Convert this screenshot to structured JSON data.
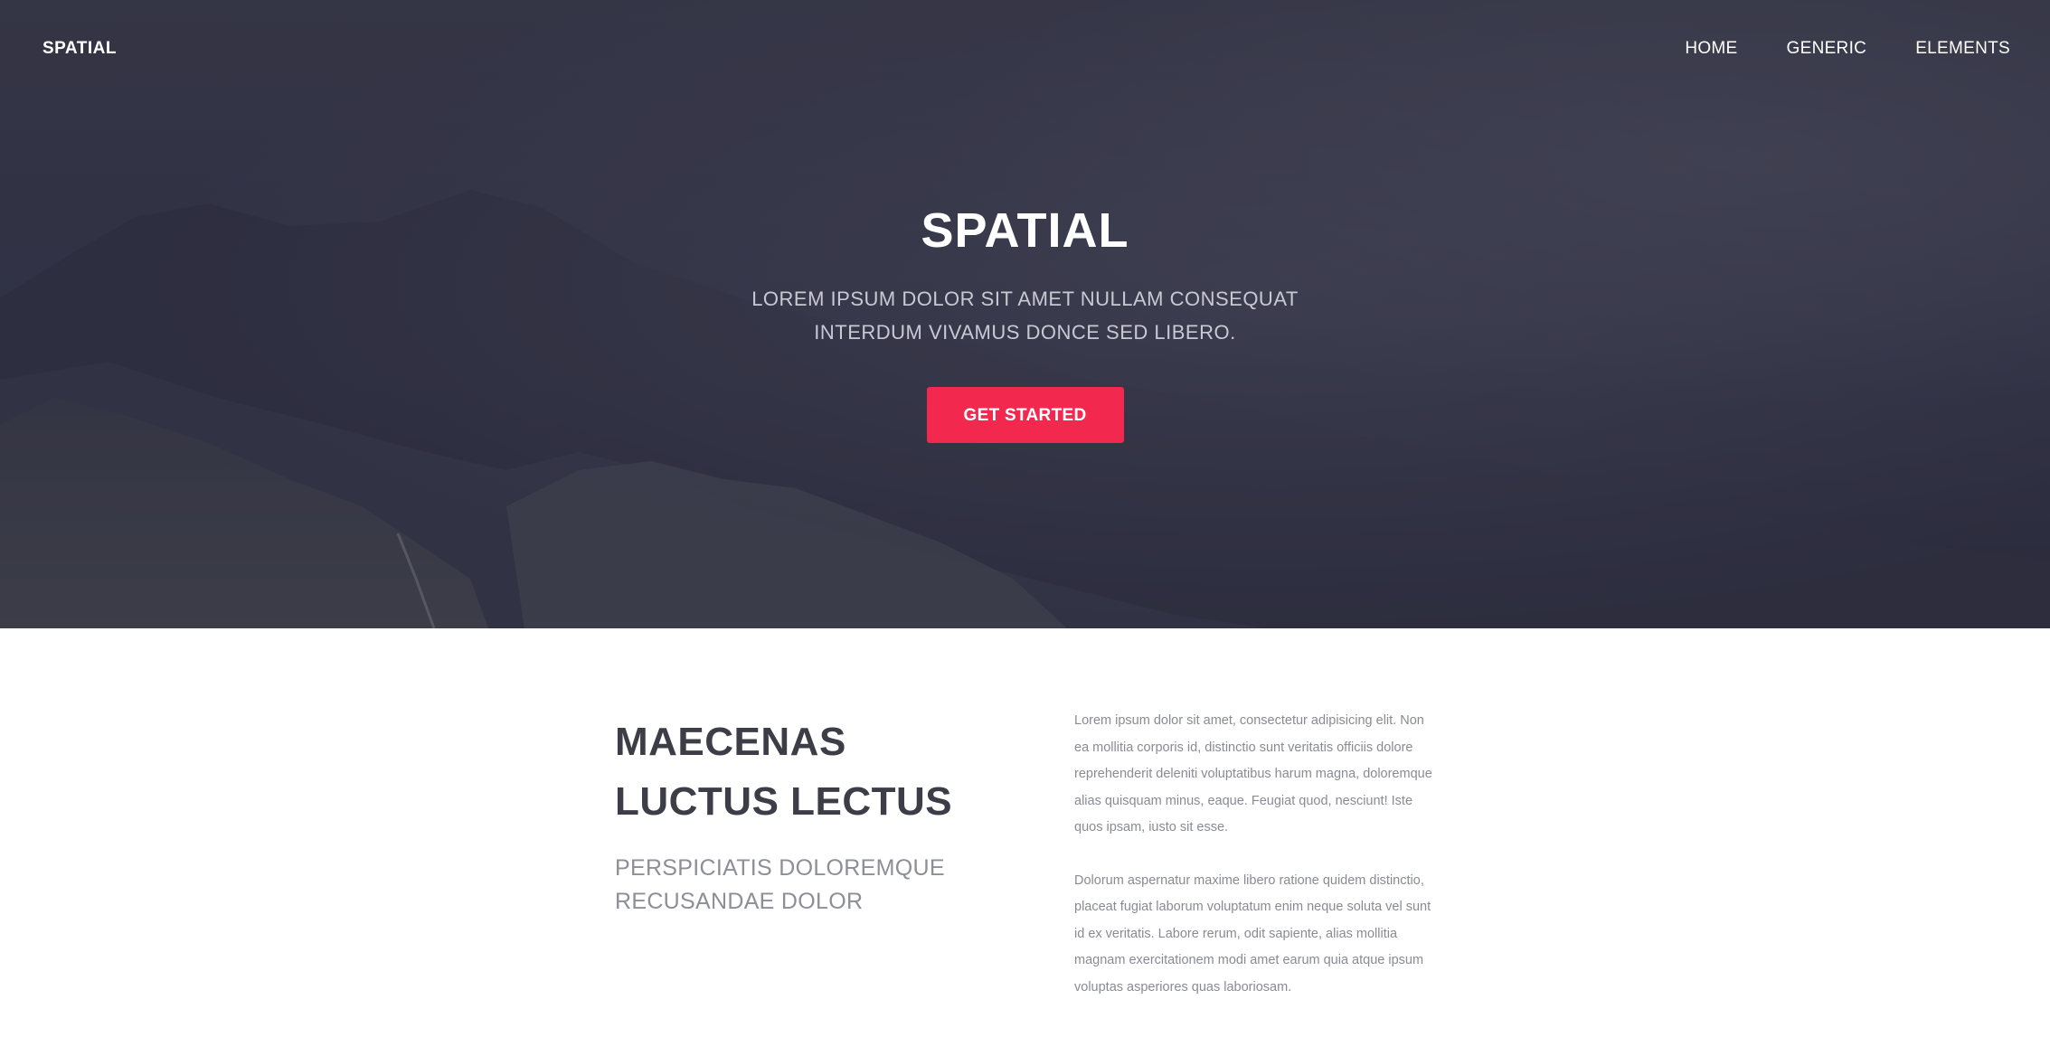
{
  "nav": {
    "logo": "SPATIAL",
    "links": [
      "HOME",
      "GENERIC",
      "ELEMENTS"
    ]
  },
  "hero": {
    "title": "SPATIAL",
    "subtitle": "LOREM IPSUM DOLOR SIT AMET NULLAM CONSEQUAT INTERDUM VIVAMUS DONCE SED LIBERO.",
    "button_label": "GET STARTED"
  },
  "section": {
    "heading": "MAECENAS LUCTUS LECTUS",
    "subheading": "PERSPICIATIS DOLOREMQUE RECUSANDAE DOLOR",
    "paragraphs": [
      "Lorem ipsum dolor sit amet, consectetur adipisicing elit. Non ea mollitia corporis id, distinctio sunt veritatis officiis dolore reprehenderit deleniti voluptatibus harum magna, doloremque alias quisquam minus, eaque. Feugiat quod, nesciunt! Iste quos ipsam, iusto sit esse.",
      "Dolorum aspernatur maxime libero ratione quidem distinctio, placeat fugiat laborum voluptatum enim neque soluta vel sunt id ex veritatis. Labore rerum, odit sapiente, alias mollitia magnam exercitationem modi amet earum quia atque ipsum voluptas asperiores quas laboriosam."
    ]
  },
  "colors": {
    "accent": "#f2284f",
    "hero_overlay": "#2d2e3d",
    "heading_text": "#3d3d47",
    "muted_text": "#8e8e98"
  }
}
